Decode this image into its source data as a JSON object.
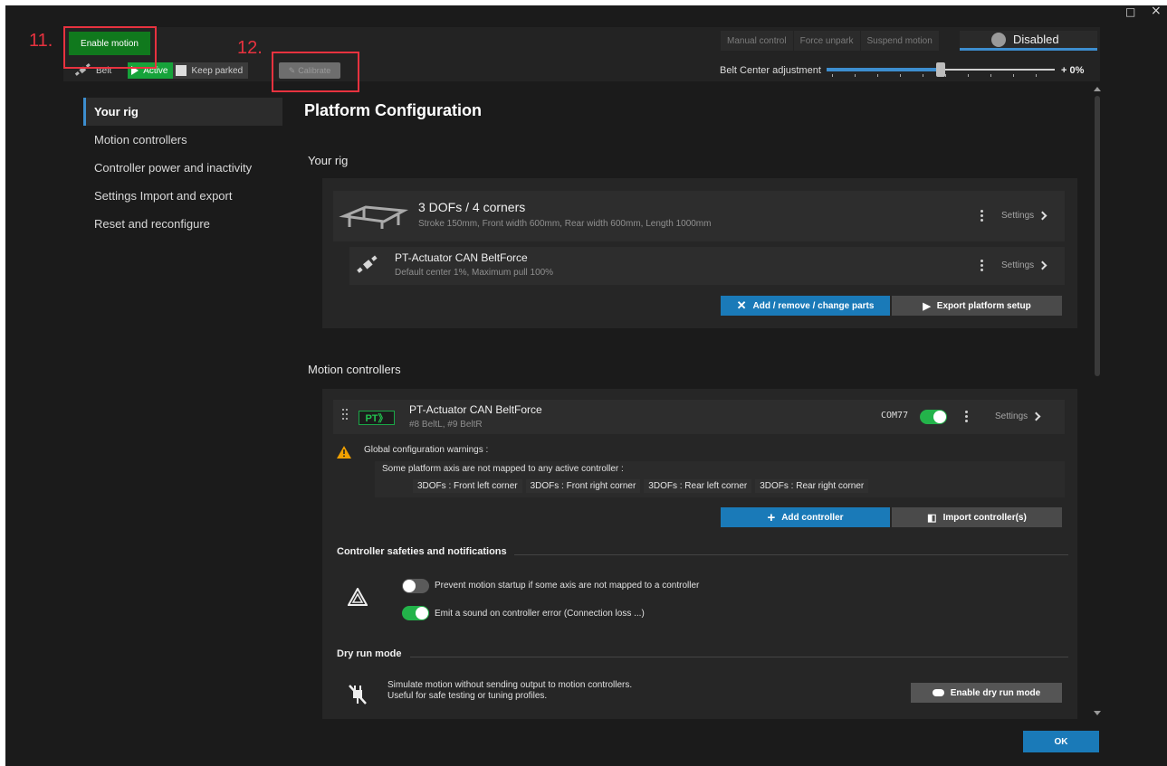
{
  "window_controls": {
    "maximize": "□",
    "close": "×"
  },
  "annotations": {
    "label_11": "11.",
    "label_12": "12."
  },
  "topbar": {
    "enable_motion": "Enable motion",
    "tabs": [
      "Manual control",
      "Force unpark",
      "Suspend motion"
    ],
    "motion_state": "Disabled",
    "belt_label": "Belt",
    "active_label": "Active",
    "keep_parked_label": "Keep parked",
    "calibrate_label": "Calibrate",
    "belt_center_label": "Belt Center adjustment",
    "belt_center_value": "+ 0%",
    "belt_center_level": 0.5
  },
  "sidebar": {
    "items": [
      {
        "label": "Your rig",
        "active": true
      },
      {
        "label": "Motion controllers",
        "active": false
      },
      {
        "label": "Controller power and inactivity",
        "active": false
      },
      {
        "label": "Settings Import and export",
        "active": false
      },
      {
        "label": "Reset and reconfigure",
        "active": false
      }
    ]
  },
  "main": {
    "title": "Platform Configuration",
    "your_rig": {
      "heading": "Your rig",
      "platform": {
        "title": "3 DOFs / 4 corners",
        "subtitle": "Stroke 150mm, Front width 600mm, Rear width 600mm, Length 1000mm",
        "settings": "Settings"
      },
      "actuator": {
        "title": "PT-Actuator CAN BeltForce",
        "subtitle": "Default center 1%, Maximum pull 100%",
        "settings": "Settings"
      },
      "add_parts_btn": "Add / remove / change parts",
      "export_btn": "Export platform setup"
    },
    "motion_controllers": {
      "heading": "Motion controllers",
      "controller": {
        "logo": "PT》",
        "title": "PT-Actuator CAN BeltForce",
        "subtitle": "#8 BeltL, #9 BeltR",
        "port": "COM77",
        "settings": "Settings"
      },
      "warning_title": "Global configuration warnings :",
      "warning_text": "Some platform axis are not mapped to any active controller :",
      "unmapped": [
        "3DOFs : Front left corner",
        "3DOFs : Front right corner",
        "3DOFs : Rear left corner",
        "3DOFs : Rear right corner"
      ],
      "add_controller_btn": "Add controller",
      "import_controller_btn": "Import controller(s)"
    },
    "safeties": {
      "heading": "Controller safeties and notifications",
      "prevent_startup": "Prevent motion startup if some axis are not mapped to a controller",
      "emit_sound": "Emit a sound on controller error (Connection loss ...)"
    },
    "dry_run": {
      "heading": "Dry run mode",
      "line1": "Simulate motion without sending output to motion controllers.",
      "line2": "Useful for safe testing or tuning profiles.",
      "button": "Enable dry run mode"
    }
  },
  "footer": {
    "ok": "OK"
  },
  "colors": {
    "accent_blue": "#1a7ab8",
    "enable_green": "#10791d",
    "active_green": "#16a33a",
    "annotation_red": "#e8323f"
  }
}
